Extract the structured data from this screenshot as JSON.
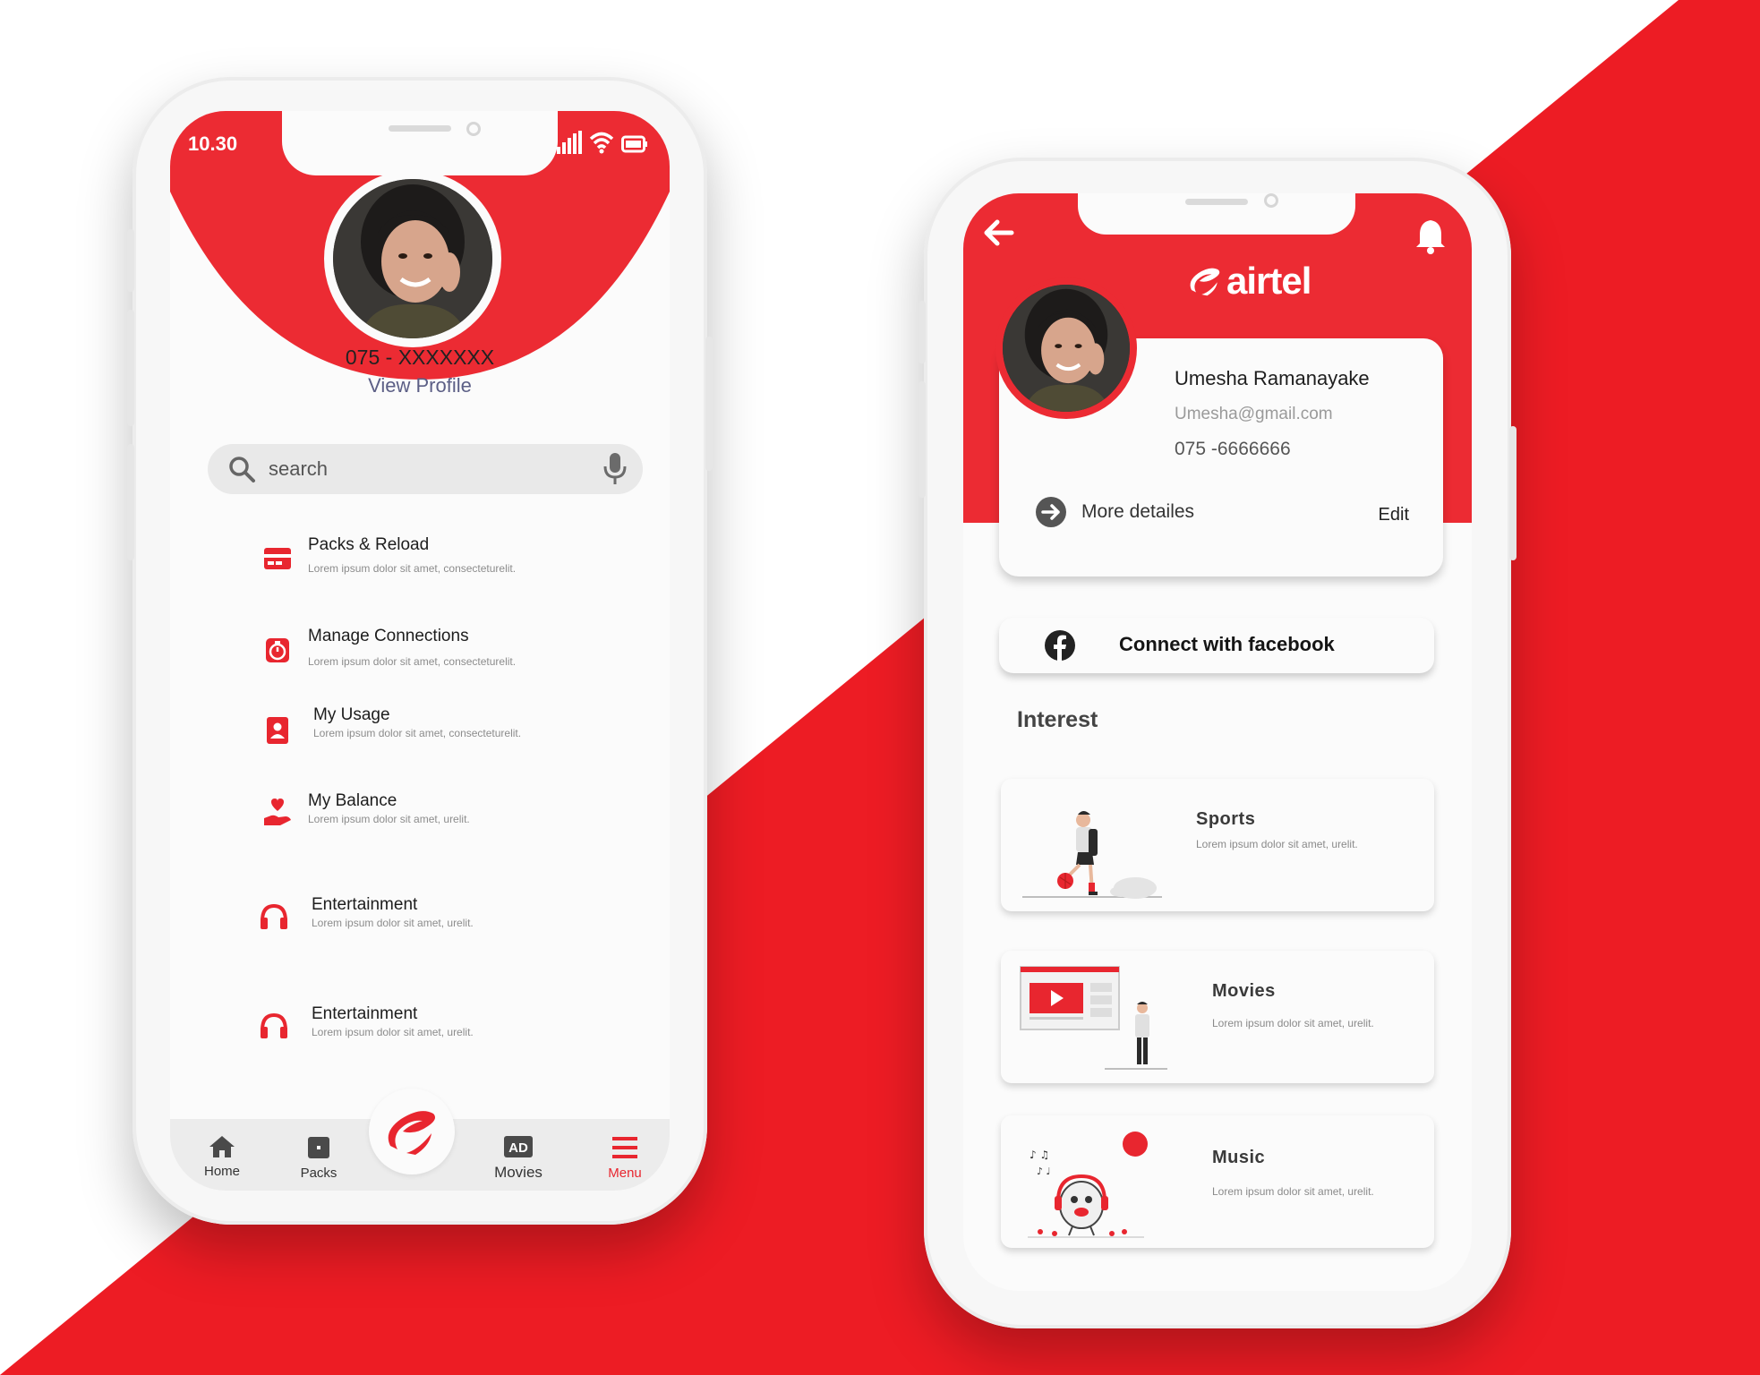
{
  "colors": {
    "brand_red": "#ec2b33",
    "background_red": "#ed1c24",
    "white": "#ffffff"
  },
  "left_phone": {
    "status": {
      "time": "10.30",
      "icons": [
        "signal-icon",
        "wifi-icon",
        "battery-icon"
      ]
    },
    "profile": {
      "phone": "075 - XXXXXXX",
      "view_profile": "View Profile"
    },
    "search": {
      "placeholder": "search",
      "icon": "search-icon",
      "mic_icon": "microphone-icon"
    },
    "menu": [
      {
        "icon": "card-icon",
        "title": "Packs & Reload",
        "desc": "Lorem ipsum dolor sit amet, consecteturelit."
      },
      {
        "icon": "timer-icon",
        "title": "Manage Connections",
        "desc": "Lorem ipsum dolor sit amet, consecteturelit."
      },
      {
        "icon": "contact-book-icon",
        "title": "My Usage",
        "desc": "Lorem ipsum dolor sit amet, consecteturelit."
      },
      {
        "icon": "heart-hand-icon",
        "title": "My Balance",
        "desc": "Lorem ipsum dolor sit amet, urelit."
      },
      {
        "icon": "headphones-icon",
        "title": "Entertainment",
        "desc": "Lorem ipsum dolor sit amet, urelit."
      },
      {
        "icon": "headphones-icon",
        "title": "Entertainment",
        "desc": "Lorem ipsum dolor sit amet, urelit."
      }
    ],
    "nav": [
      {
        "icon": "home-icon",
        "label": "Home"
      },
      {
        "icon": "packs-icon",
        "label": "Packs"
      },
      {
        "icon": "airtel-logo-icon",
        "label": ""
      },
      {
        "icon": "ad-icon",
        "label": "Movies"
      },
      {
        "icon": "menu-icon",
        "label": "Menu",
        "active": true
      }
    ]
  },
  "right_phone": {
    "brand": "airtel",
    "profile": {
      "name": "Umesha Ramanayake",
      "email": "Umesha@gmail.com",
      "phone": "075 -6666666",
      "more": "More detailes",
      "edit": "Edit"
    },
    "facebook": {
      "label": "Connect with facebook"
    },
    "interest_title": "Interest",
    "interests": [
      {
        "title": "Sports",
        "desc": "Lorem ipsum dolor sit amet, urelit.",
        "illustration": "football-player-illustration"
      },
      {
        "title": "Movies",
        "desc": "Lorem ipsum dolor sit amet, urelit.",
        "illustration": "video-player-illustration"
      },
      {
        "title": "Music",
        "desc": "Lorem ipsum dolor sit amet, urelit.",
        "illustration": "music-character-illustration"
      }
    ]
  }
}
